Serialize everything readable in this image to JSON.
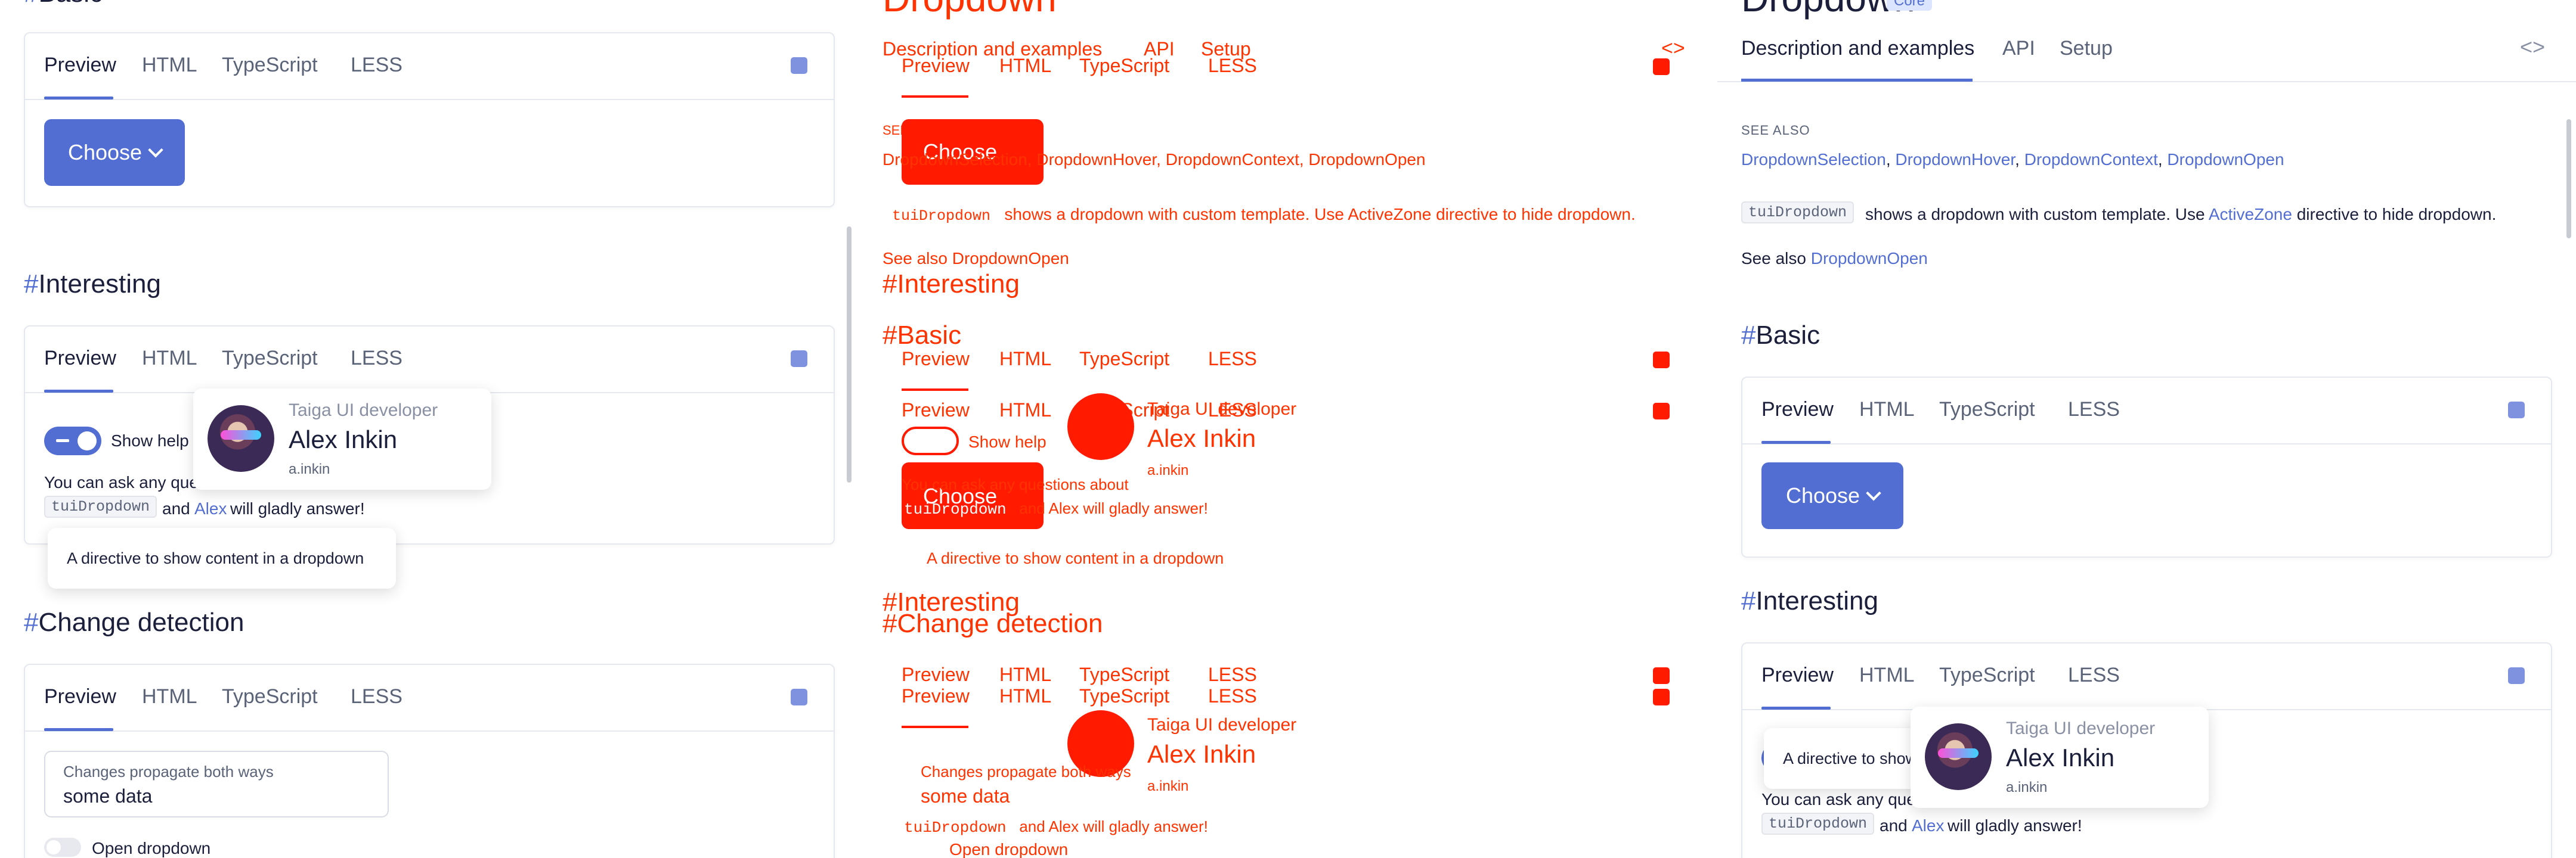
{
  "colors": {
    "accent": "#526ed3",
    "diff_red": "#ff3300",
    "link": "#526ed3"
  },
  "page": {
    "title": "Dropdown",
    "title_badge": "Core",
    "tabs": [
      "Description and examples",
      "API",
      "Setup"
    ],
    "code_toggle_icon": "code-brackets-icon",
    "see_also_label": "SEE ALSO",
    "see_also_links": [
      "DropdownSelection",
      "DropdownHover",
      "DropdownContext",
      "DropdownOpen"
    ],
    "intro_code": "tuiDropdown",
    "intro_text_1": "shows a dropdown with custom template. Use",
    "intro_link": "ActiveZone",
    "intro_text_2": "directive to hide dropdown.",
    "see_also_prefix": "See also",
    "see_also_inline_link": "DropdownOpen"
  },
  "demo_tabs": [
    "Preview",
    "HTML",
    "TypeScript",
    "LESS"
  ],
  "sections": {
    "basic": {
      "hash": "#",
      "title": "Basic",
      "button_label": "Choose"
    },
    "interesting": {
      "hash": "#",
      "title": "Interesting",
      "toggle_label": "Show help",
      "text_1": "You can ask any questions about",
      "code": "tuiDropdown",
      "text_and": "and",
      "link": "Alex",
      "text_2": "will gladly answer!",
      "tooltip": "A directive to show content in a dropdown",
      "profile": {
        "role": "Taiga UI developer",
        "name": "Alex Inkin",
        "handle": "a.inkin"
      }
    },
    "change_detection": {
      "hash": "#",
      "title": "Change detection",
      "field_label": "Changes propagate both ways",
      "field_value": "some data",
      "toggle_label": "Open dropdown"
    }
  }
}
